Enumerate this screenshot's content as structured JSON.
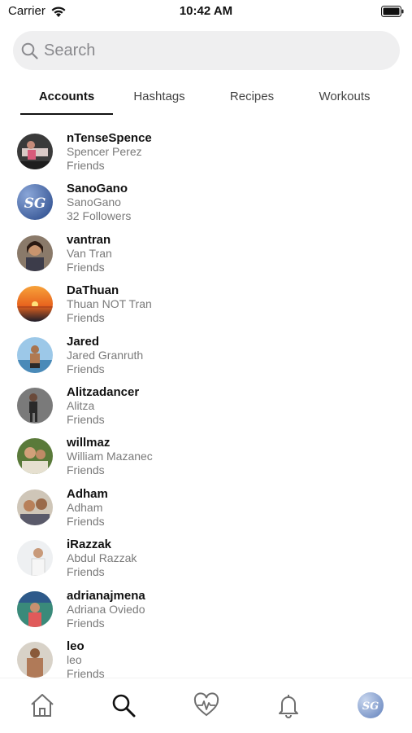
{
  "status_bar": {
    "carrier": "Carrier",
    "time": "10:42 AM"
  },
  "search": {
    "placeholder": "Search",
    "value": ""
  },
  "tabs": [
    {
      "label": "Accounts",
      "active": true
    },
    {
      "label": "Hashtags",
      "active": false
    },
    {
      "label": "Recipes",
      "active": false
    },
    {
      "label": "Workouts",
      "active": false
    }
  ],
  "accounts": [
    {
      "username": "nTenseSpence",
      "name": "Spencer Perez",
      "relation": "Friends"
    },
    {
      "username": "SanoGano",
      "name": "SanoGano",
      "relation": "32 Followers"
    },
    {
      "username": "vantran",
      "name": "Van Tran",
      "relation": "Friends"
    },
    {
      "username": "DaThuan",
      "name": "Thuan NOT Tran",
      "relation": "Friends"
    },
    {
      "username": "Jared",
      "name": "Jared Granruth",
      "relation": "Friends"
    },
    {
      "username": "Alitzadancer",
      "name": "Alitza",
      "relation": "Friends"
    },
    {
      "username": "willmaz",
      "name": "William Mazanec",
      "relation": "Friends"
    },
    {
      "username": "Adham",
      "name": "Adham",
      "relation": "Friends"
    },
    {
      "username": "iRazzak",
      "name": "Abdul Razzak",
      "relation": "Friends"
    },
    {
      "username": "adrianajmena",
      "name": "Adriana Oviedo",
      "relation": "Friends"
    },
    {
      "username": "leo",
      "name": "leo",
      "relation": "Friends"
    }
  ],
  "bottom_nav": [
    {
      "icon": "home-icon",
      "active": false
    },
    {
      "icon": "search-icon",
      "active": true
    },
    {
      "icon": "heartbeat-icon",
      "active": false
    },
    {
      "icon": "bell-icon",
      "active": false
    },
    {
      "icon": "profile-avatar",
      "active": false
    }
  ],
  "colors": {
    "search_bg": "#efeff0",
    "placeholder": "#8a8a8e",
    "secondary_text": "#7a7a7a",
    "tab_underline": "#111111",
    "brand_blue": "#4a6fb0"
  }
}
